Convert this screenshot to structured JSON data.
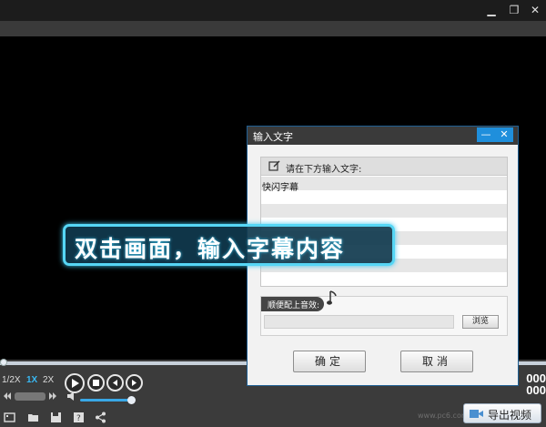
{
  "window": {
    "restore_icon": "restore-icon",
    "close_icon": "close-icon"
  },
  "player": {
    "speeds": [
      "1/2X",
      "1X",
      "2X"
    ],
    "active_speed": "1X",
    "timecode_top": "000",
    "timecode_bottom": "000",
    "volume_level": 0.9,
    "seek_position": 0.0,
    "tool_icons": [
      "film-icon",
      "folder-icon",
      "save-icon",
      "help-icon",
      "share-icon"
    ],
    "export_label": "导出视频",
    "watermark": "www.pc6.com"
  },
  "dialog": {
    "title": "输入文字",
    "minimize_icon": "minimize-icon",
    "close_icon": "close-icon",
    "input_header": "请在下方输入文字:",
    "input_value": "快闪字幕",
    "sound_header": "顺便配上音效:",
    "sound_path": "",
    "browse_label": "浏览",
    "ok_label": "确定",
    "cancel_label": "取消"
  },
  "caption": {
    "text": "双击画面，输入字幕内容"
  },
  "colors": {
    "accent": "#39b9f4",
    "caption_border": "#56d6f5",
    "dialog_titlebar": "#3a3a3a"
  }
}
